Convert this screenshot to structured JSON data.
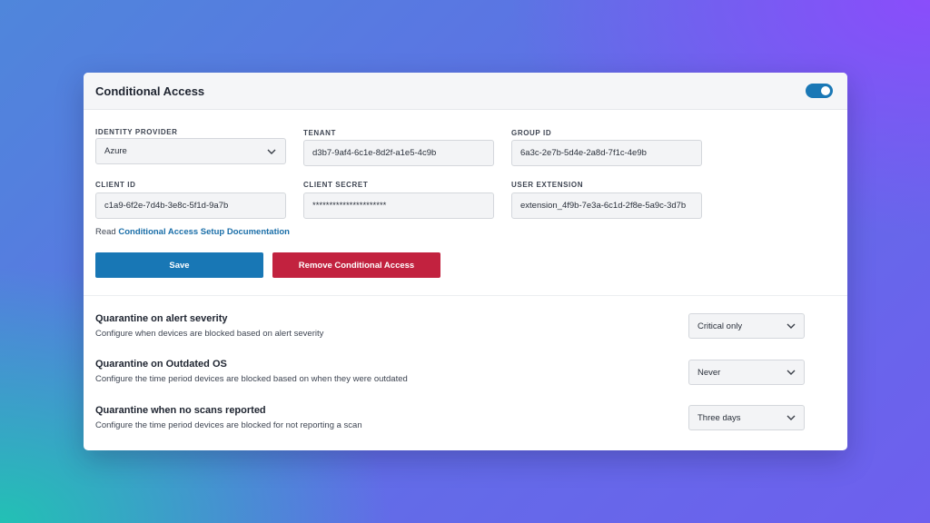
{
  "header": {
    "title": "Conditional Access",
    "enabled": true
  },
  "fields": {
    "identity_provider": {
      "label": "IDENTITY PROVIDER",
      "value": "Azure"
    },
    "tenant": {
      "label": "TENANT",
      "value": "d3b7-9af4-6c1e-8d2f-a1e5-4c9b"
    },
    "group_id": {
      "label": "GROUP ID",
      "value": "6a3c-2e7b-5d4e-2a8d-7f1c-4e9b"
    },
    "client_id": {
      "label": "CLIENT ID",
      "value": "c1a9-6f2e-7d4b-3e8c-5f1d-9a7b"
    },
    "client_secret": {
      "label": "CLIENT SECRET",
      "value": "**********************"
    },
    "user_extension": {
      "label": "USER EXTENSION",
      "value": "extension_4f9b-7e3a-6c1d-2f8e-5a9c-3d7b"
    }
  },
  "docs": {
    "prefix": "Read",
    "link_text": "Conditional Access Setup Documentation"
  },
  "actions": {
    "save_label": "Save",
    "remove_label": "Remove Conditional Access"
  },
  "quarantine": [
    {
      "title": "Quarantine on alert severity",
      "description": "Configure when devices are blocked based on alert severity",
      "value": "Critical only"
    },
    {
      "title": "Quarantine on Outdated OS",
      "description": "Configure the time period devices are blocked based on when they were outdated",
      "value": "Never"
    },
    {
      "title": "Quarantine when no scans reported",
      "description": "Configure the time period devices are blocked for not reporting a scan",
      "value": "Three days"
    }
  ],
  "colors": {
    "accent": "#1877b5",
    "danger": "#c2223f",
    "toggle_on": "#1a78b6"
  }
}
